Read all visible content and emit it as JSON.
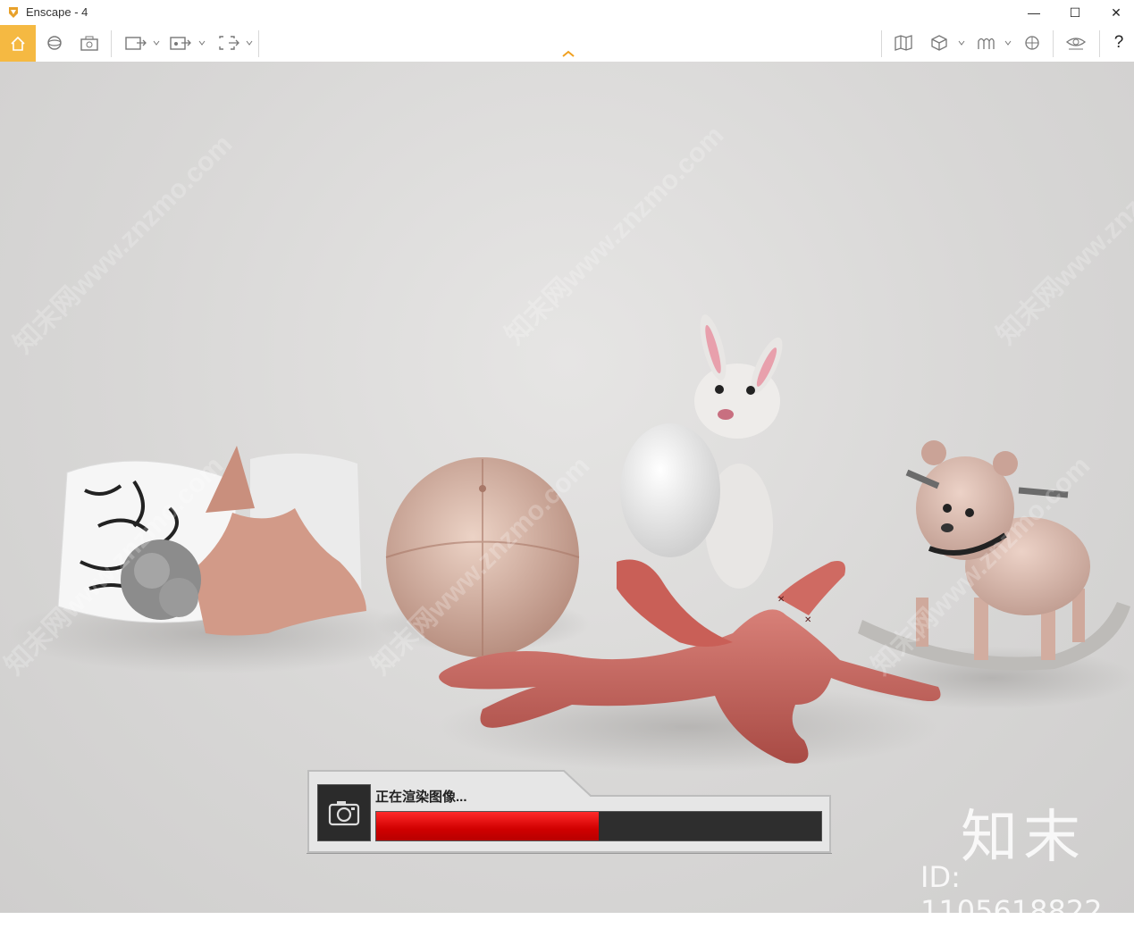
{
  "window": {
    "title": "Enscape - 4",
    "min": "—",
    "max": "☐",
    "close": "✕"
  },
  "toolbar": {
    "left_icons": [
      "home-icon",
      "orbit-icon",
      "screenshot-settings-icon",
      "render-image-icon",
      "render-video-icon",
      "export-icon"
    ],
    "right_icons": [
      "map-icon",
      "view-cube-icon",
      "assets-icon",
      "navigation-icon",
      "visibility-icon"
    ],
    "help_label": "?"
  },
  "viewport": {
    "watermark_text": "知末网www.znzmo.com",
    "objects": [
      "pillows",
      "pouf",
      "bunny-with-egg",
      "plush-rabbit",
      "rocking-bear"
    ]
  },
  "render_progress": {
    "status": "正在渲染图像...",
    "progress": 0.5,
    "bar_color": "#e00000"
  },
  "brand": {
    "name": "知末",
    "id_text": "ID: 1105618822"
  },
  "colors": {
    "accent": "#f5b942"
  }
}
